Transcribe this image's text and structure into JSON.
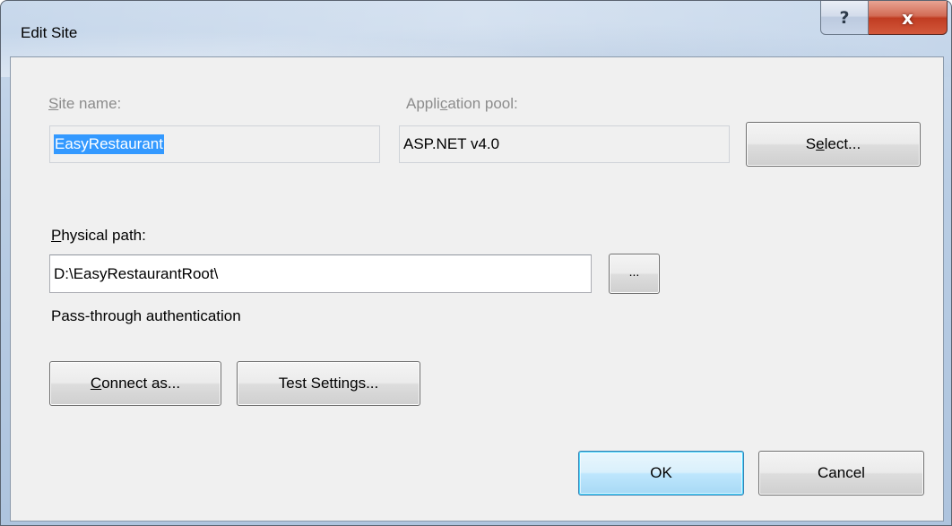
{
  "window": {
    "title": "Edit Site",
    "help_glyph": "?",
    "close_glyph": "x"
  },
  "site_name": {
    "label_first": "S",
    "label_rest": "ite name:",
    "value": "EasyRestaurant"
  },
  "application_pool": {
    "label_pre": "Appli",
    "label_u": "c",
    "label_post": "ation pool:",
    "value": "ASP.NET v4.0"
  },
  "select_button": {
    "pre": "S",
    "u": "e",
    "post": "lect..."
  },
  "physical_path": {
    "label_first": "P",
    "label_rest": "hysical path:",
    "value": "D:\\EasyRestaurantRoot\\",
    "browse_label": "..."
  },
  "auth_status": "Pass-through authentication",
  "connect_as_button": {
    "first": "C",
    "rest": "onnect as..."
  },
  "test_settings_button": {
    "pre": "Test Settin",
    "u": "g",
    "post": "s..."
  },
  "ok_button": "OK",
  "cancel_button": "Cancel"
}
